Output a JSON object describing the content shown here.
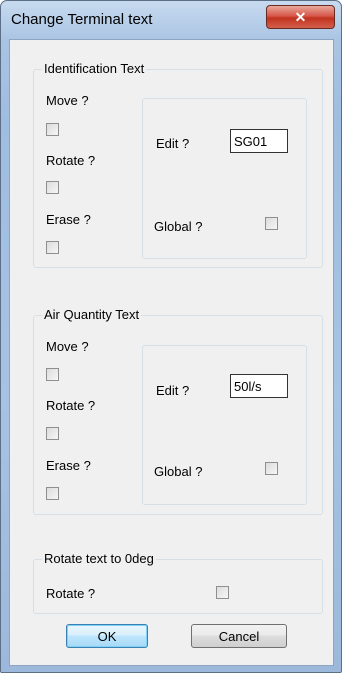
{
  "window": {
    "title": "Change Terminal text",
    "close_glyph": "✕"
  },
  "identification": {
    "legend": "Identification Text",
    "move_label": "Move  ?",
    "rotate_label": "Rotate ?",
    "erase_label": "Erase  ?",
    "edit_label": "Edit  ?",
    "edit_value": "SG01",
    "global_label": "Global ?"
  },
  "air_quantity": {
    "legend": "Air Quantity Text",
    "move_label": "Move  ?",
    "rotate_label": "Rotate ?",
    "erase_label": "Erase  ?",
    "edit_label": "Edit  ?",
    "edit_value": "50l/s",
    "global_label": "Global ?"
  },
  "rotate_zero": {
    "legend": "Rotate text to 0deg",
    "rotate_label": "Rotate ?"
  },
  "buttons": {
    "ok": "OK",
    "cancel": "Cancel"
  }
}
